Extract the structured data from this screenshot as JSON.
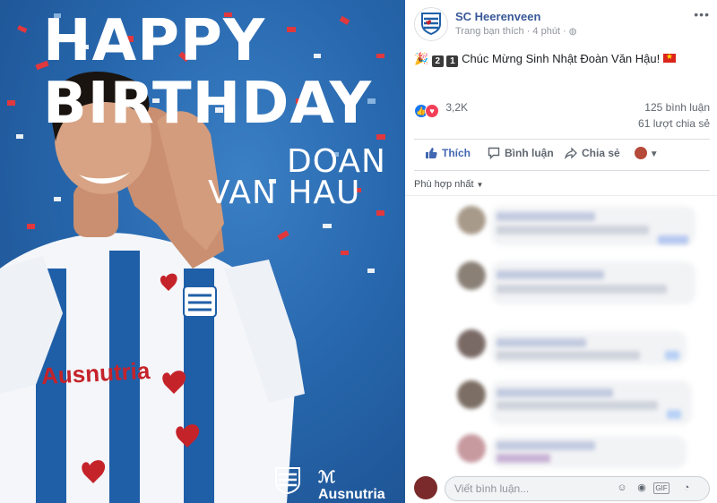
{
  "post": {
    "page_name": "SC Heerenveen",
    "meta": "Trang bạn thích · 4 phút ·",
    "more_icon": "more-horizontal-icon",
    "message_keycap_1": "2",
    "message_keycap_2": "1",
    "message_text": "Chúc Mừng Sinh Nhật Đoàn Văn Hậu!",
    "reaction_count": "3,2K",
    "comment_count": "125 bình luận",
    "share_count": "61 lượt chia sẻ"
  },
  "image": {
    "line1": "HAPPY",
    "line2": "BIRTHDAY",
    "name_line1": "DOAN",
    "name_line2": "VAN HAU",
    "sponsor": "Ausnutria",
    "shirt_sponsor": "Ausnutria"
  },
  "actions": {
    "like": "Thích",
    "comment": "Bình luận",
    "share": "Chia sẻ"
  },
  "comments": {
    "sort_label": "Phù hợp nhất"
  },
  "composer": {
    "placeholder": "Viết bình luận..."
  },
  "colors": {
    "link": "#385898",
    "like_blue": "#4267b2",
    "photo_blue": "#2767ad"
  }
}
